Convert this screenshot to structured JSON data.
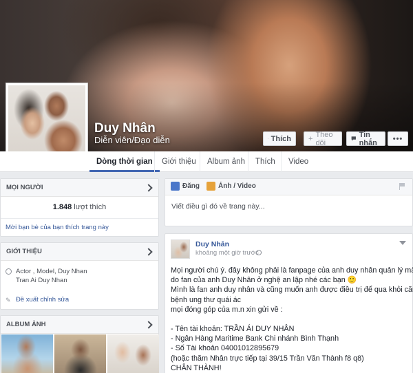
{
  "page": {
    "name": "Duy Nhân",
    "category": "Diễn viên/Đạo diễn"
  },
  "actions": {
    "like": "Thích",
    "follow": "Theo dõi",
    "message": "Tin nhắn",
    "more": "•••"
  },
  "tabs": [
    "Dòng thời gian",
    "Giới thiệu",
    "Album ảnh",
    "Thích",
    "Video"
  ],
  "people": {
    "heading": "MỌI NGƯỜI",
    "like_count": "1.848",
    "like_suffix": "lượt thích",
    "invite": "Mời bạn bè của bạn thích trang này"
  },
  "about": {
    "heading": "GIỚI THIỆU",
    "line1": "Actor , Model, Duy Nhan",
    "line2": "Tran Ai Duy Nhan",
    "suggest": "Đề xuất chỉnh sửa"
  },
  "album": {
    "heading": "ALBUM ẢNH"
  },
  "composer": {
    "post_tab": "Đăng",
    "photo_tab": "Ảnh / Video",
    "placeholder": "Viết điều gì đó về trang này..."
  },
  "post": {
    "author": "Duy Nhân",
    "time": "khoảng một giờ trước ·",
    "lines": [
      "Mọi người chú ý. đây không phải là fanpage của anh duy nhân quản lý mà là",
      "do fan của anh Duy Nhân ở nghệ an lập nhé các bạn 🙂",
      "Mình là fan anh duy nhân và cũng muốn anh được điều trị để qua khỏi căn",
      "bệnh ung thư quái ác",
      "mọi đóng góp của m.n xin gửi về :",
      "",
      "- Tên tài khoản: TRẦN ÁI DUY NHÂN",
      "- Ngân Hàng Maritime Bank Chi nhánh Bình Thạnh",
      "- Số Tài khoản 04001012895679",
      "(hoặc thăm Nhân trực tiếp tại 39/15 Trần Văn Thành f8 q8)",
      "CHÂN THÀNH!"
    ]
  }
}
